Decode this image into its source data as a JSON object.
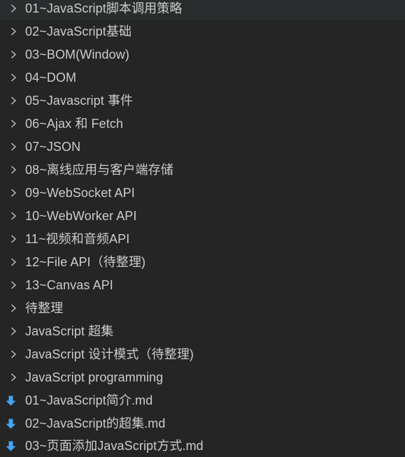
{
  "explorer": {
    "items": [
      {
        "label": "01~JavaScript脚本调用策略",
        "kind": "folder",
        "icon": "chevron-right-icon"
      },
      {
        "label": "02~JavaScript基础",
        "kind": "folder",
        "icon": "chevron-right-icon"
      },
      {
        "label": "03~BOM(Window)",
        "kind": "folder",
        "icon": "chevron-right-icon"
      },
      {
        "label": "04~DOM",
        "kind": "folder",
        "icon": "chevron-right-icon"
      },
      {
        "label": "05~Javascript 事件",
        "kind": "folder",
        "icon": "chevron-right-icon"
      },
      {
        "label": "06~Ajax 和 Fetch",
        "kind": "folder",
        "icon": "chevron-right-icon"
      },
      {
        "label": "07~JSON",
        "kind": "folder",
        "icon": "chevron-right-icon"
      },
      {
        "label": "08~离线应用与客户端存储",
        "kind": "folder",
        "icon": "chevron-right-icon"
      },
      {
        "label": "09~WebSocket API",
        "kind": "folder",
        "icon": "chevron-right-icon"
      },
      {
        "label": "10~WebWorker API",
        "kind": "folder",
        "icon": "chevron-right-icon"
      },
      {
        "label": "11~视频和音频API",
        "kind": "folder",
        "icon": "chevron-right-icon"
      },
      {
        "label": "12~File API（待整理)",
        "kind": "folder",
        "icon": "chevron-right-icon"
      },
      {
        "label": "13~Canvas API",
        "kind": "folder",
        "icon": "chevron-right-icon"
      },
      {
        "label": "待整理",
        "kind": "folder",
        "icon": "chevron-right-icon"
      },
      {
        "label": "JavaScript 超集",
        "kind": "folder",
        "icon": "chevron-right-icon"
      },
      {
        "label": "JavaScript 设计模式（待整理)",
        "kind": "folder",
        "icon": "chevron-right-icon"
      },
      {
        "label": "JavaScript programming",
        "kind": "folder",
        "icon": "chevron-right-icon"
      },
      {
        "label": "01~JavaScript简介.md",
        "kind": "file",
        "icon": "markdown-arrow-icon"
      },
      {
        "label": "02~JavaScript的超集.md",
        "kind": "file",
        "icon": "markdown-arrow-icon"
      },
      {
        "label": "03~页面添加JavaScript方式.md",
        "kind": "file",
        "icon": "markdown-arrow-icon"
      }
    ]
  },
  "colors": {
    "background": "#252526",
    "text": "#cccccc",
    "chevron": "#c5c5c5",
    "markdown_icon": "#42a5f5"
  }
}
